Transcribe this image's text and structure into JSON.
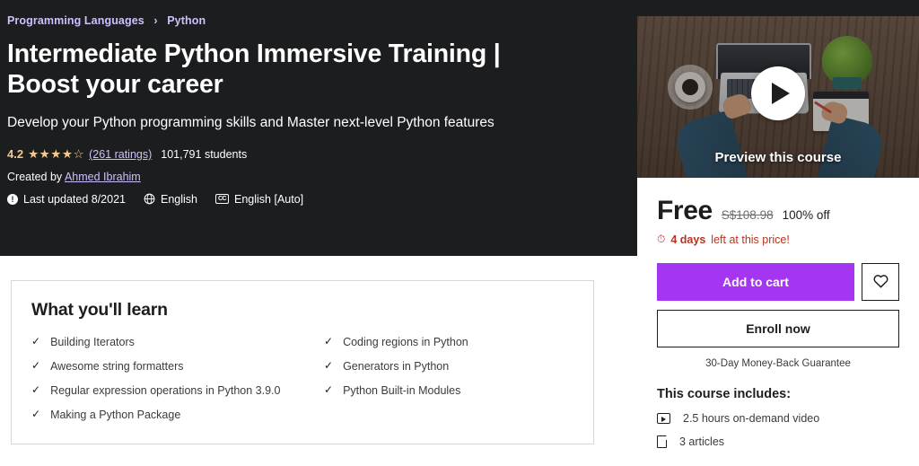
{
  "breadcrumb": {
    "items": [
      "Programming Languages",
      "Python"
    ],
    "separator": "›"
  },
  "hero": {
    "title": "Intermediate Python Immersive Training | Boost your career",
    "subtitle": "Develop your Python programming skills and Master next-level Python features",
    "rating": {
      "value": "4.2",
      "stars": "★★★★☆",
      "ratings_link": "(261 ratings)",
      "students": "101,791 students"
    },
    "created_by_prefix": "Created by",
    "instructor": "Ahmed Ibrahim",
    "meta": {
      "last_updated": "Last updated 8/2021",
      "language": "English",
      "captions": "English [Auto]",
      "alert_icon_glyph": "!",
      "globe_icon_glyph": "⊕",
      "cc_icon_text": "CC"
    },
    "background_color": "#1c1d1f",
    "link_color": "#cec0fc",
    "star_color": "#f3ca8c"
  },
  "learn": {
    "title": "What you'll learn",
    "check_glyph": "✓",
    "items_left": [
      "Building Iterators",
      "Awesome string formatters",
      "Regular expression operations in Python 3.9.0",
      "Making a Python Package"
    ],
    "items_right": [
      "Coding regions in Python",
      "Generators in Python",
      "Python Built-in Modules"
    ]
  },
  "card": {
    "preview_label": "Preview this course",
    "price": {
      "current": "Free",
      "original": "S$108.98",
      "discount": "100% off"
    },
    "deadline": {
      "clock_glyph": "⏱",
      "bold_part": "4 days",
      "rest": "left at this price!"
    },
    "add_to_cart_label": "Add to cart",
    "wishlist_icon": "heart-icon",
    "enroll_label": "Enroll now",
    "guarantee": "30-Day Money-Back Guarantee",
    "includes_title": "This course includes:",
    "includes": [
      {
        "icon": "video-icon",
        "label": "2.5 hours on-demand video"
      },
      {
        "icon": "document-icon",
        "label": "3 articles"
      }
    ],
    "accent_color": "#a435f0",
    "deadline_color": "#b4341f"
  }
}
